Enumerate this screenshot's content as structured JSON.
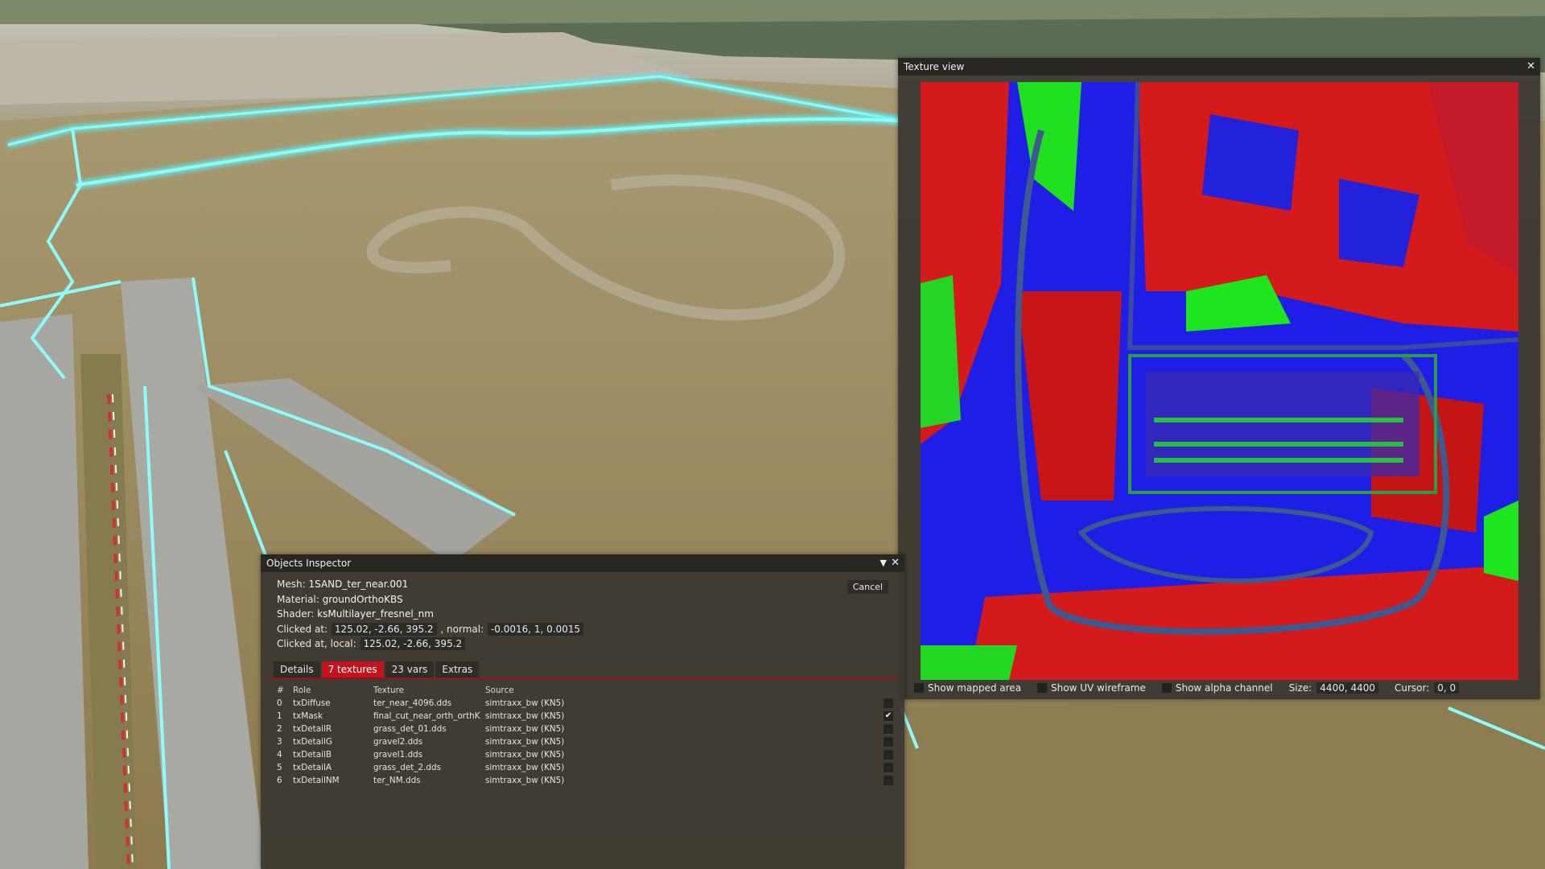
{
  "inspector": {
    "title": "Objects Inspector",
    "mesh_label": "Mesh:",
    "mesh_value": "1SAND_ter_near.001",
    "material_label": "Material:",
    "material_value": "groundOrthoKBS",
    "shader_label": "Shader:",
    "shader_value": "ksMultilayer_fresnel_nm",
    "clicked_label": "Clicked at:",
    "clicked_value": "125.02, -2.66, 395.2",
    "normal_label": ", normal:",
    "normal_value": "-0.0016, 1, 0.0015",
    "clicked_local_label": "Clicked at, local:",
    "clicked_local_value": "125.02, -2.66, 395.2",
    "cancel_label": "Cancel",
    "tabs": [
      "Details",
      "7 textures",
      "23 vars",
      "Extras"
    ],
    "active_tab": 1,
    "table_headers": [
      "#",
      "Role",
      "Texture",
      "Source"
    ],
    "textures": [
      {
        "num": "0",
        "role": "txDiffuse",
        "texture": "ter_near_4096.dds",
        "source": "simtraxx_bw (KN5)",
        "checked": false
      },
      {
        "num": "1",
        "role": "txMask",
        "texture": "final_cut_near_orth_orthK",
        "source": "simtraxx_bw (KN5)",
        "checked": true
      },
      {
        "num": "2",
        "role": "txDetailR",
        "texture": "grass_det_01.dds",
        "source": "simtraxx_bw (KN5)",
        "checked": false
      },
      {
        "num": "3",
        "role": "txDetailG",
        "texture": "gravel2.dds",
        "source": "simtraxx_bw (KN5)",
        "checked": false
      },
      {
        "num": "4",
        "role": "txDetailB",
        "texture": "gravel1.dds",
        "source": "simtraxx_bw (KN5)",
        "checked": false
      },
      {
        "num": "5",
        "role": "txDetailA",
        "texture": "grass_det_2.dds",
        "source": "simtraxx_bw (KN5)",
        "checked": false
      },
      {
        "num": "6",
        "role": "txDetailNM",
        "texture": "ter_NM.dds",
        "source": "simtraxx_bw (KN5)",
        "checked": false
      }
    ]
  },
  "texture_view": {
    "title": "Texture view",
    "show_mapped_area": "Show mapped area",
    "show_uv_wireframe": "Show UV wireframe",
    "show_alpha_channel": "Show alpha channel",
    "size_label": "Size:",
    "size_value": "4400, 4400",
    "cursor_label": "Cursor:",
    "cursor_value": "0, 0"
  },
  "icons": {
    "close": "close-icon",
    "collapse": "triangle-down-icon",
    "check": "checkmark-icon"
  },
  "colors": {
    "accent": "#c0141e",
    "highlight_outline": "#5ff0f0",
    "mask_red": "#d81818",
    "mask_green": "#1ee61e",
    "mask_blue": "#1e1ee6"
  }
}
